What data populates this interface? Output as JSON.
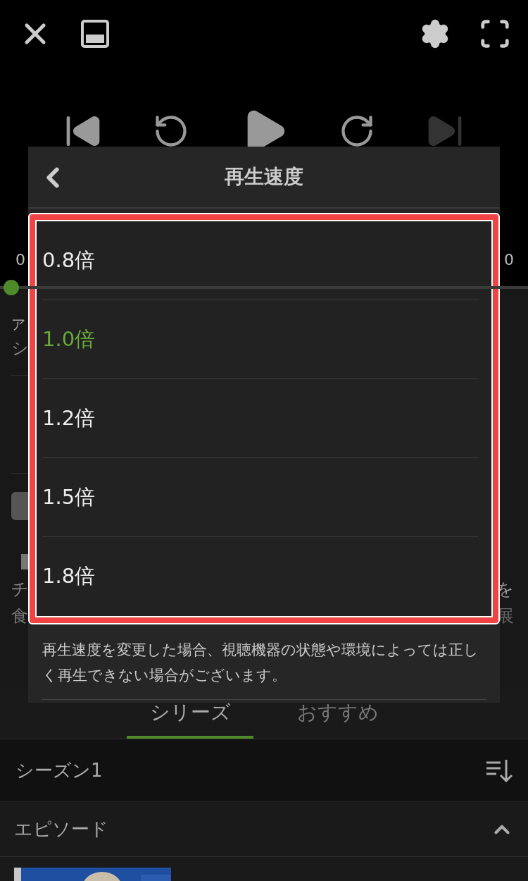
{
  "player": {
    "time_elapsed": "0",
    "time_total": "0",
    "progress": {
      "level": 0
    }
  },
  "info": {
    "title": "ア",
    "subtitle": "シ",
    "left_lines": [
      "チ",
      "食"
    ],
    "right_lines": [
      "を",
      "展"
    ]
  },
  "tabs": [
    {
      "label": "シリーズ",
      "selected": true
    },
    {
      "label": "おすすめ",
      "selected": false
    }
  ],
  "season": {
    "label": "シーズン1"
  },
  "episodes_header": {
    "label": "エピソード",
    "expanded": true
  },
  "speed_menu": {
    "title": "再生速度",
    "options": [
      {
        "label": "0.8倍",
        "selected": false
      },
      {
        "label": "1.0倍",
        "selected": true
      },
      {
        "label": "1.2倍",
        "selected": false
      },
      {
        "label": "1.5倍",
        "selected": false
      },
      {
        "label": "1.8倍",
        "selected": false
      }
    ],
    "note": "再生速度を変更した場合、視聴機器の状態や環境によっては正しく再生できない場合がございます。"
  }
}
